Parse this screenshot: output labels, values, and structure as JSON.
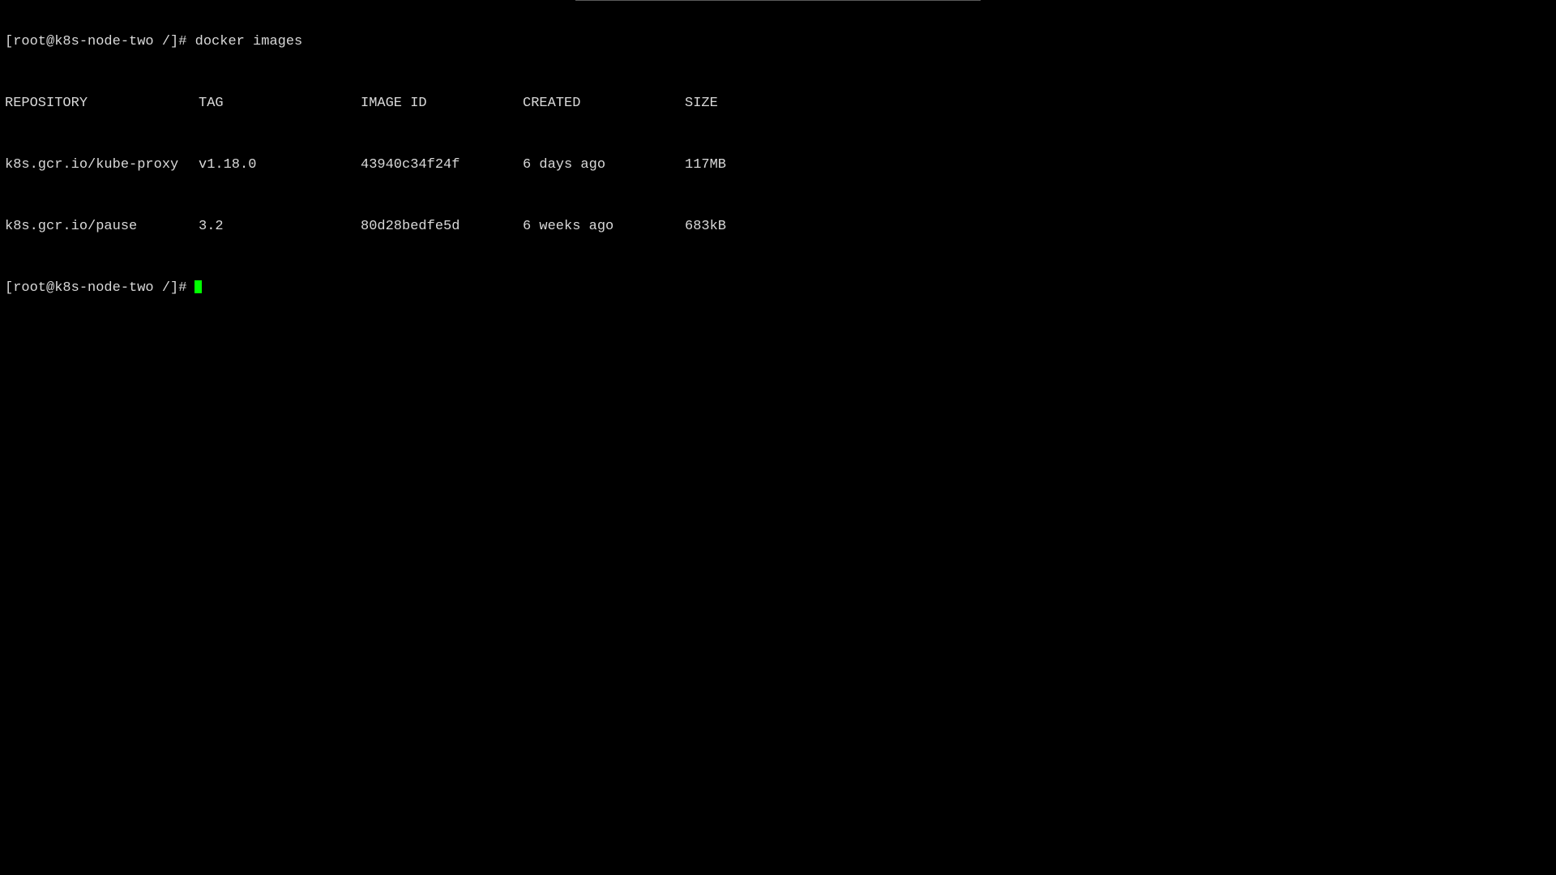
{
  "terminal": {
    "command_line": {
      "prompt": "[root@k8s-node-two /]#",
      "command": "docker images"
    },
    "table": {
      "headers": [
        "REPOSITORY",
        "TAG",
        "IMAGE ID",
        "CREATED",
        "SIZE"
      ],
      "rows": [
        [
          "k8s.gcr.io/kube-proxy",
          "v1.18.0",
          "43940c34f24f",
          "6 days ago",
          "117MB"
        ],
        [
          "k8s.gcr.io/pause",
          "3.2",
          "80d28bedfe5d",
          "6 weeks ago",
          "683kB"
        ]
      ]
    },
    "current_prompt": "[root@k8s-node-two /]#",
    "cursor_color": "#00ff00",
    "text_color": "#d9d9d9",
    "background_color": "#000000"
  }
}
